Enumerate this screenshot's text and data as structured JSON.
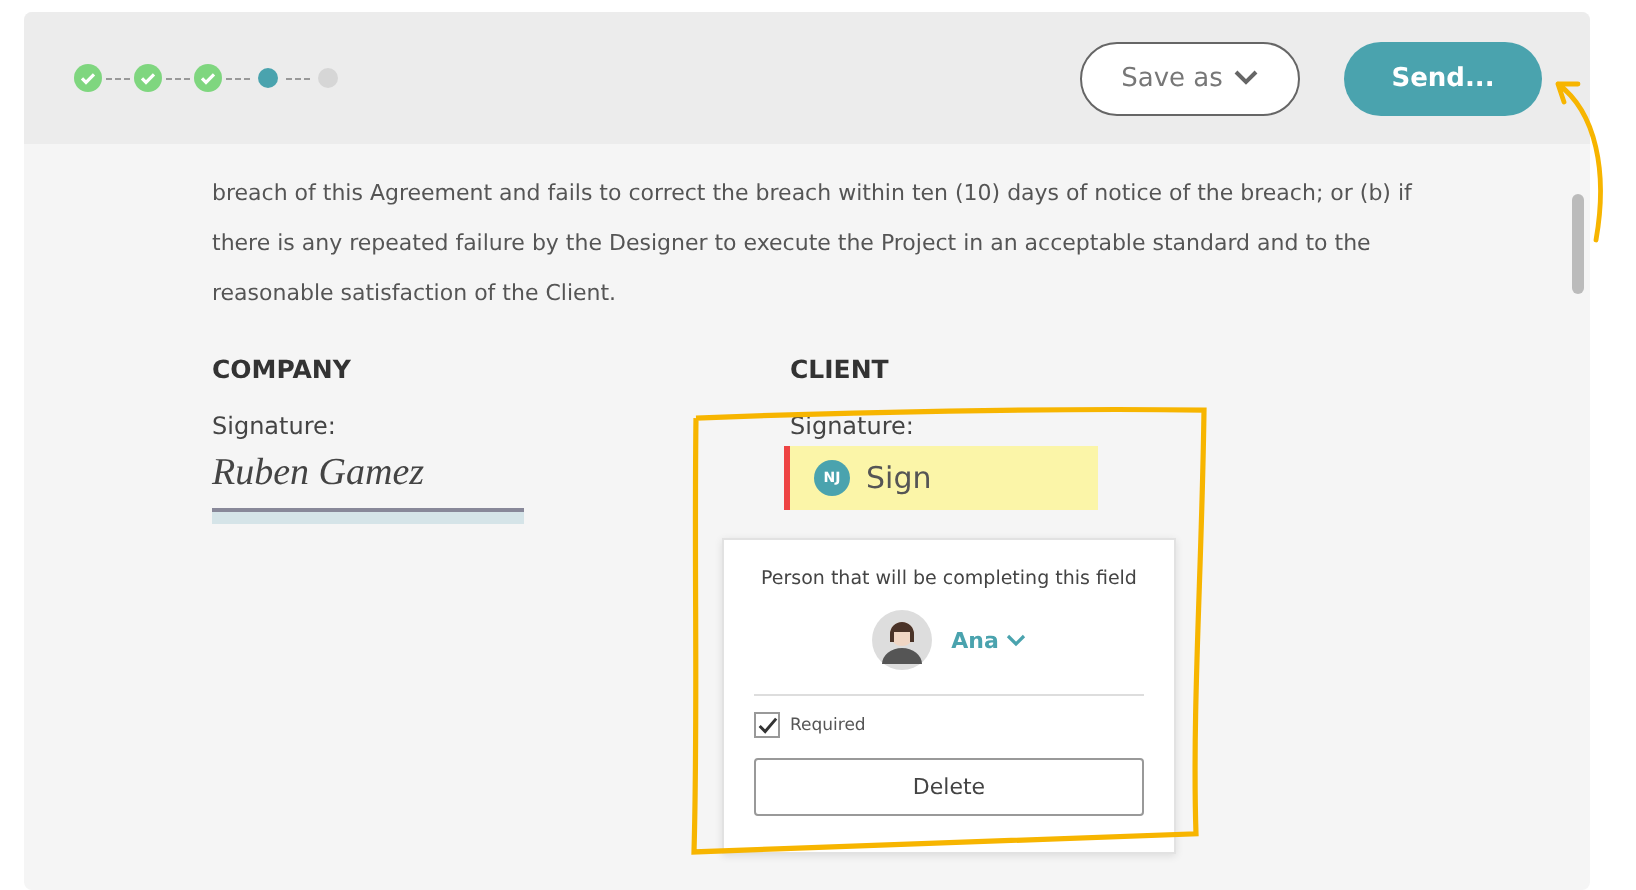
{
  "steps": [
    {
      "kind": "done"
    },
    {
      "kind": "done"
    },
    {
      "kind": "done"
    },
    {
      "kind": "current"
    },
    {
      "kind": "todo"
    }
  ],
  "header": {
    "save_button": "Save as",
    "send_button": "Send..."
  },
  "body_lines": [
    "breach of this Agreement and fails to correct the breach within ten (10) days of notice of the breach; or (b) if",
    "there is any repeated failure by the Designer to execute the Project in an acceptable standard and to the",
    "reasonable satisfaction of the Client."
  ],
  "company": {
    "heading": "COMPANY",
    "label": "Signature:",
    "signature": "Ruben Gamez"
  },
  "client": {
    "heading": "CLIENT",
    "label": "Signature:",
    "field": {
      "initials": "NJ",
      "text": "Sign"
    }
  },
  "popover": {
    "prompt": "Person that will be completing this field",
    "person": "Ana",
    "required": {
      "label": "Required",
      "checked": true
    },
    "delete_button": "Delete"
  }
}
